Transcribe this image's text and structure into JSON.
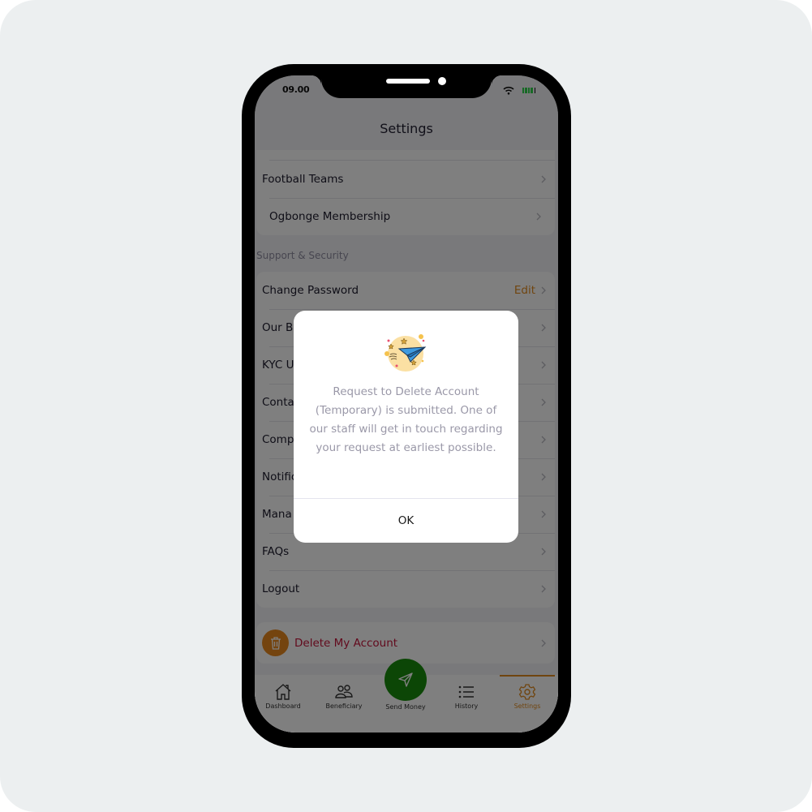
{
  "status_bar": {
    "time": "09.00",
    "wifi_icon": "wifi-icon",
    "battery_icon": "battery-icon",
    "battery_color": "#2fd34b"
  },
  "header": {
    "title": "Settings"
  },
  "groups": [
    {
      "items": [
        {
          "label": "Football Teams"
        },
        {
          "label": "Ogbonge Membership"
        }
      ]
    }
  ],
  "support_section": {
    "title": "Support & Security",
    "items": [
      {
        "label": "Change Password",
        "action": "Edit"
      },
      {
        "label": "Our Bo"
      },
      {
        "label": "KYC U"
      },
      {
        "label": "Conta"
      },
      {
        "label": "Comp"
      },
      {
        "label": "Notific"
      },
      {
        "label": "Mana"
      },
      {
        "label": "FAQs"
      },
      {
        "label": "Logout"
      }
    ]
  },
  "danger": {
    "label": "Delete My Account",
    "icon": "trash-icon",
    "color": "#c4143a",
    "icon_bg": "#e9891e"
  },
  "tabbar": {
    "tabs": [
      {
        "label": "Dashboard",
        "icon": "home-icon"
      },
      {
        "label": "Beneficiary",
        "icon": "users-icon"
      },
      {
        "label": "Send Money",
        "icon": "send-icon"
      },
      {
        "label": "History",
        "icon": "list-icon"
      },
      {
        "label": "Settings",
        "icon": "gear-icon",
        "active": true
      }
    ],
    "accent": "#e08a1e",
    "fab_color": "#198c0c"
  },
  "dialog": {
    "illustration": "paper-plane-icon",
    "message": "Request to Delete Account (Temporary) is submitted. One of our staff will get in touch regarding your request at earliest possible.",
    "ok_label": "OK"
  }
}
